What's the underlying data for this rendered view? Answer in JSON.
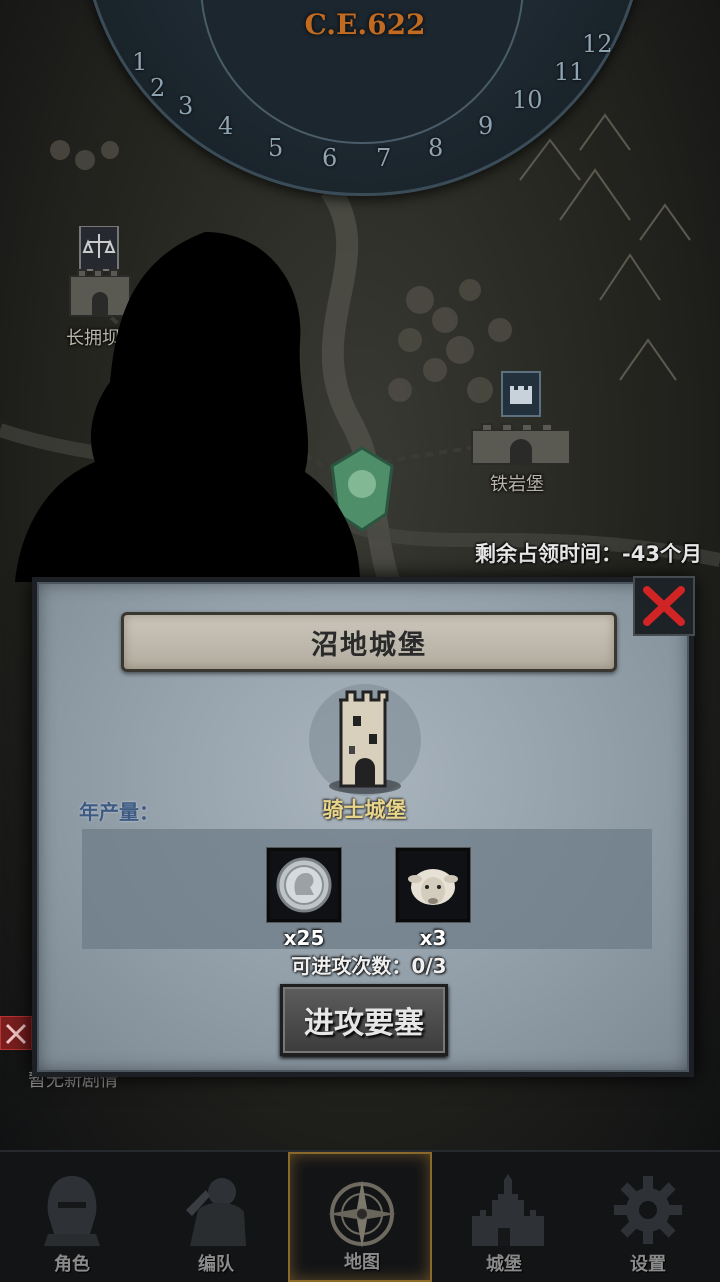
{
  "map": {
    "year_label": "C.E.622",
    "month_numbers": [
      "1",
      "2",
      "3",
      "4",
      "5",
      "6",
      "7",
      "8",
      "9",
      "10",
      "11",
      "12"
    ],
    "castle_left_label": "长拥坝",
    "castle_right_label": "铁岩堡",
    "occupy_time_text": "剩余占领时间：-43个月",
    "story_hint": "暂无新剧情"
  },
  "dialog": {
    "title": "沼地城堡",
    "fortress_type": "骑士城堡",
    "annual_production_label": "年产量：",
    "resources": [
      {
        "icon": "silver-coin-icon",
        "count": "x25"
      },
      {
        "icon": "sheep-icon",
        "count": "x3"
      }
    ],
    "attack_count_text": "可进攻次数：0/3",
    "attack_button_label": "进攻要塞"
  },
  "nav": {
    "items": [
      {
        "label": "角色",
        "icon": "knight-helmet-icon"
      },
      {
        "label": "编队",
        "icon": "knight-armor-icon"
      },
      {
        "label": "地图",
        "icon": "compass-icon"
      },
      {
        "label": "城堡",
        "icon": "castle-icon"
      },
      {
        "label": "设置",
        "icon": "gear-icon"
      }
    ],
    "active_index": 2
  },
  "colors": {
    "accent_gold": "#e8d58a",
    "close_red": "#d12424",
    "label_blue": "#3e5a82",
    "year_orange": "#c06a22"
  }
}
